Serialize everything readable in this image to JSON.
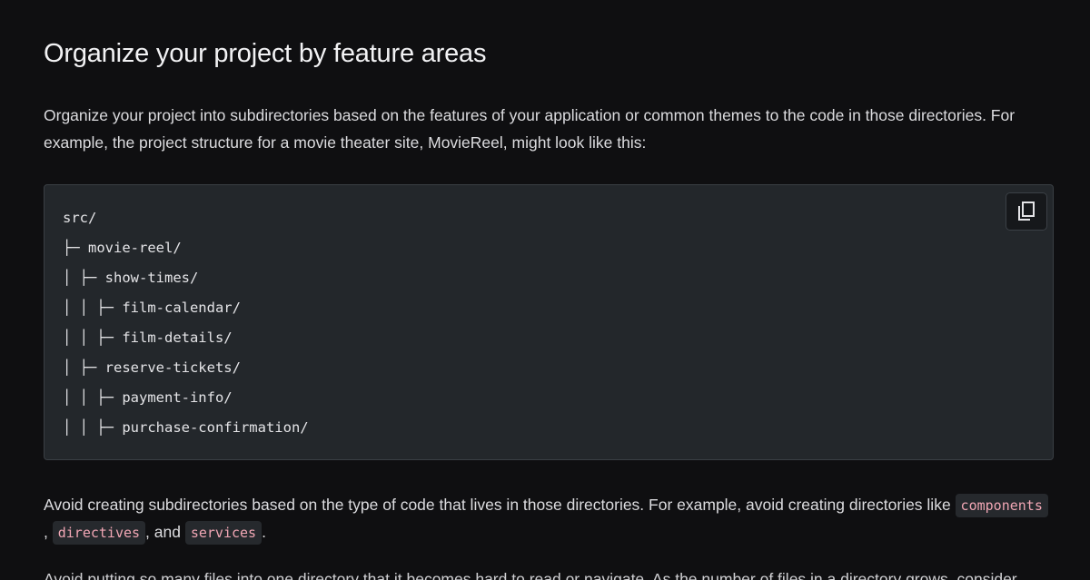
{
  "section": {
    "title": "Organize your project by feature areas",
    "intro": "Organize your project into subdirectories based on the features of your application or common themes to the code in those directories. For example, the project structure for a movie theater site, MovieReel, might look like this:"
  },
  "code_block": {
    "lines": [
      "src/",
      "├─ movie-reel/",
      "│ ├─ show-times/",
      "│ │ ├─ film-calendar/",
      "│ │ ├─ film-details/",
      "│ ├─ reserve-tickets/",
      "│ │ ├─ payment-info/",
      "│ │ ├─ purchase-confirmation/"
    ],
    "copy_icon": "copy-icon"
  },
  "avoid": {
    "text_before": "Avoid creating subdirectories based on the type of code that lives in those directories. For example, avoid creating directories like ",
    "code1": "components",
    "sep1": ", ",
    "code2": "directives",
    "sep2": ", and ",
    "code3": "services",
    "text_after": "."
  },
  "next_paragraph": {
    "text": "Avoid putting so many files into one directory that it becomes hard to read or navigate. As the number of files in a directory grows, consider"
  },
  "colors": {
    "background": "#0f0f11",
    "code_background": "#23272b",
    "inline_code_text": "#f0a6b4"
  }
}
